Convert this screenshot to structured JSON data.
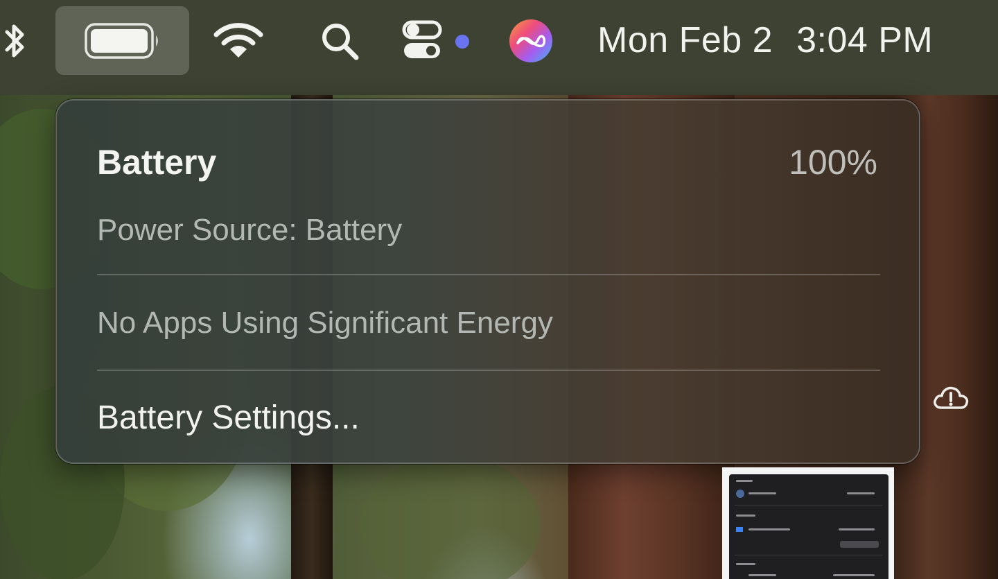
{
  "menubar": {
    "items": [
      {
        "name": "bluetooth-icon"
      },
      {
        "name": "battery-icon",
        "level": 1.0
      },
      {
        "name": "wifi-icon"
      },
      {
        "name": "search-icon"
      },
      {
        "name": "control-center-icon"
      },
      {
        "name": "siri-icon"
      }
    ],
    "clock": {
      "day": "Mon Feb 2",
      "time": "3:04 PM"
    },
    "indicator_color": "#6b74f0"
  },
  "battery_menu": {
    "title": "Battery",
    "percent": "100%",
    "power_source": "Power Source: Battery",
    "energy_status": "No Apps Using Significant Energy",
    "settings_label": "Battery Settings..."
  },
  "desktop": {
    "icons": [
      {
        "name": "cloud-alert-icon"
      }
    ]
  }
}
